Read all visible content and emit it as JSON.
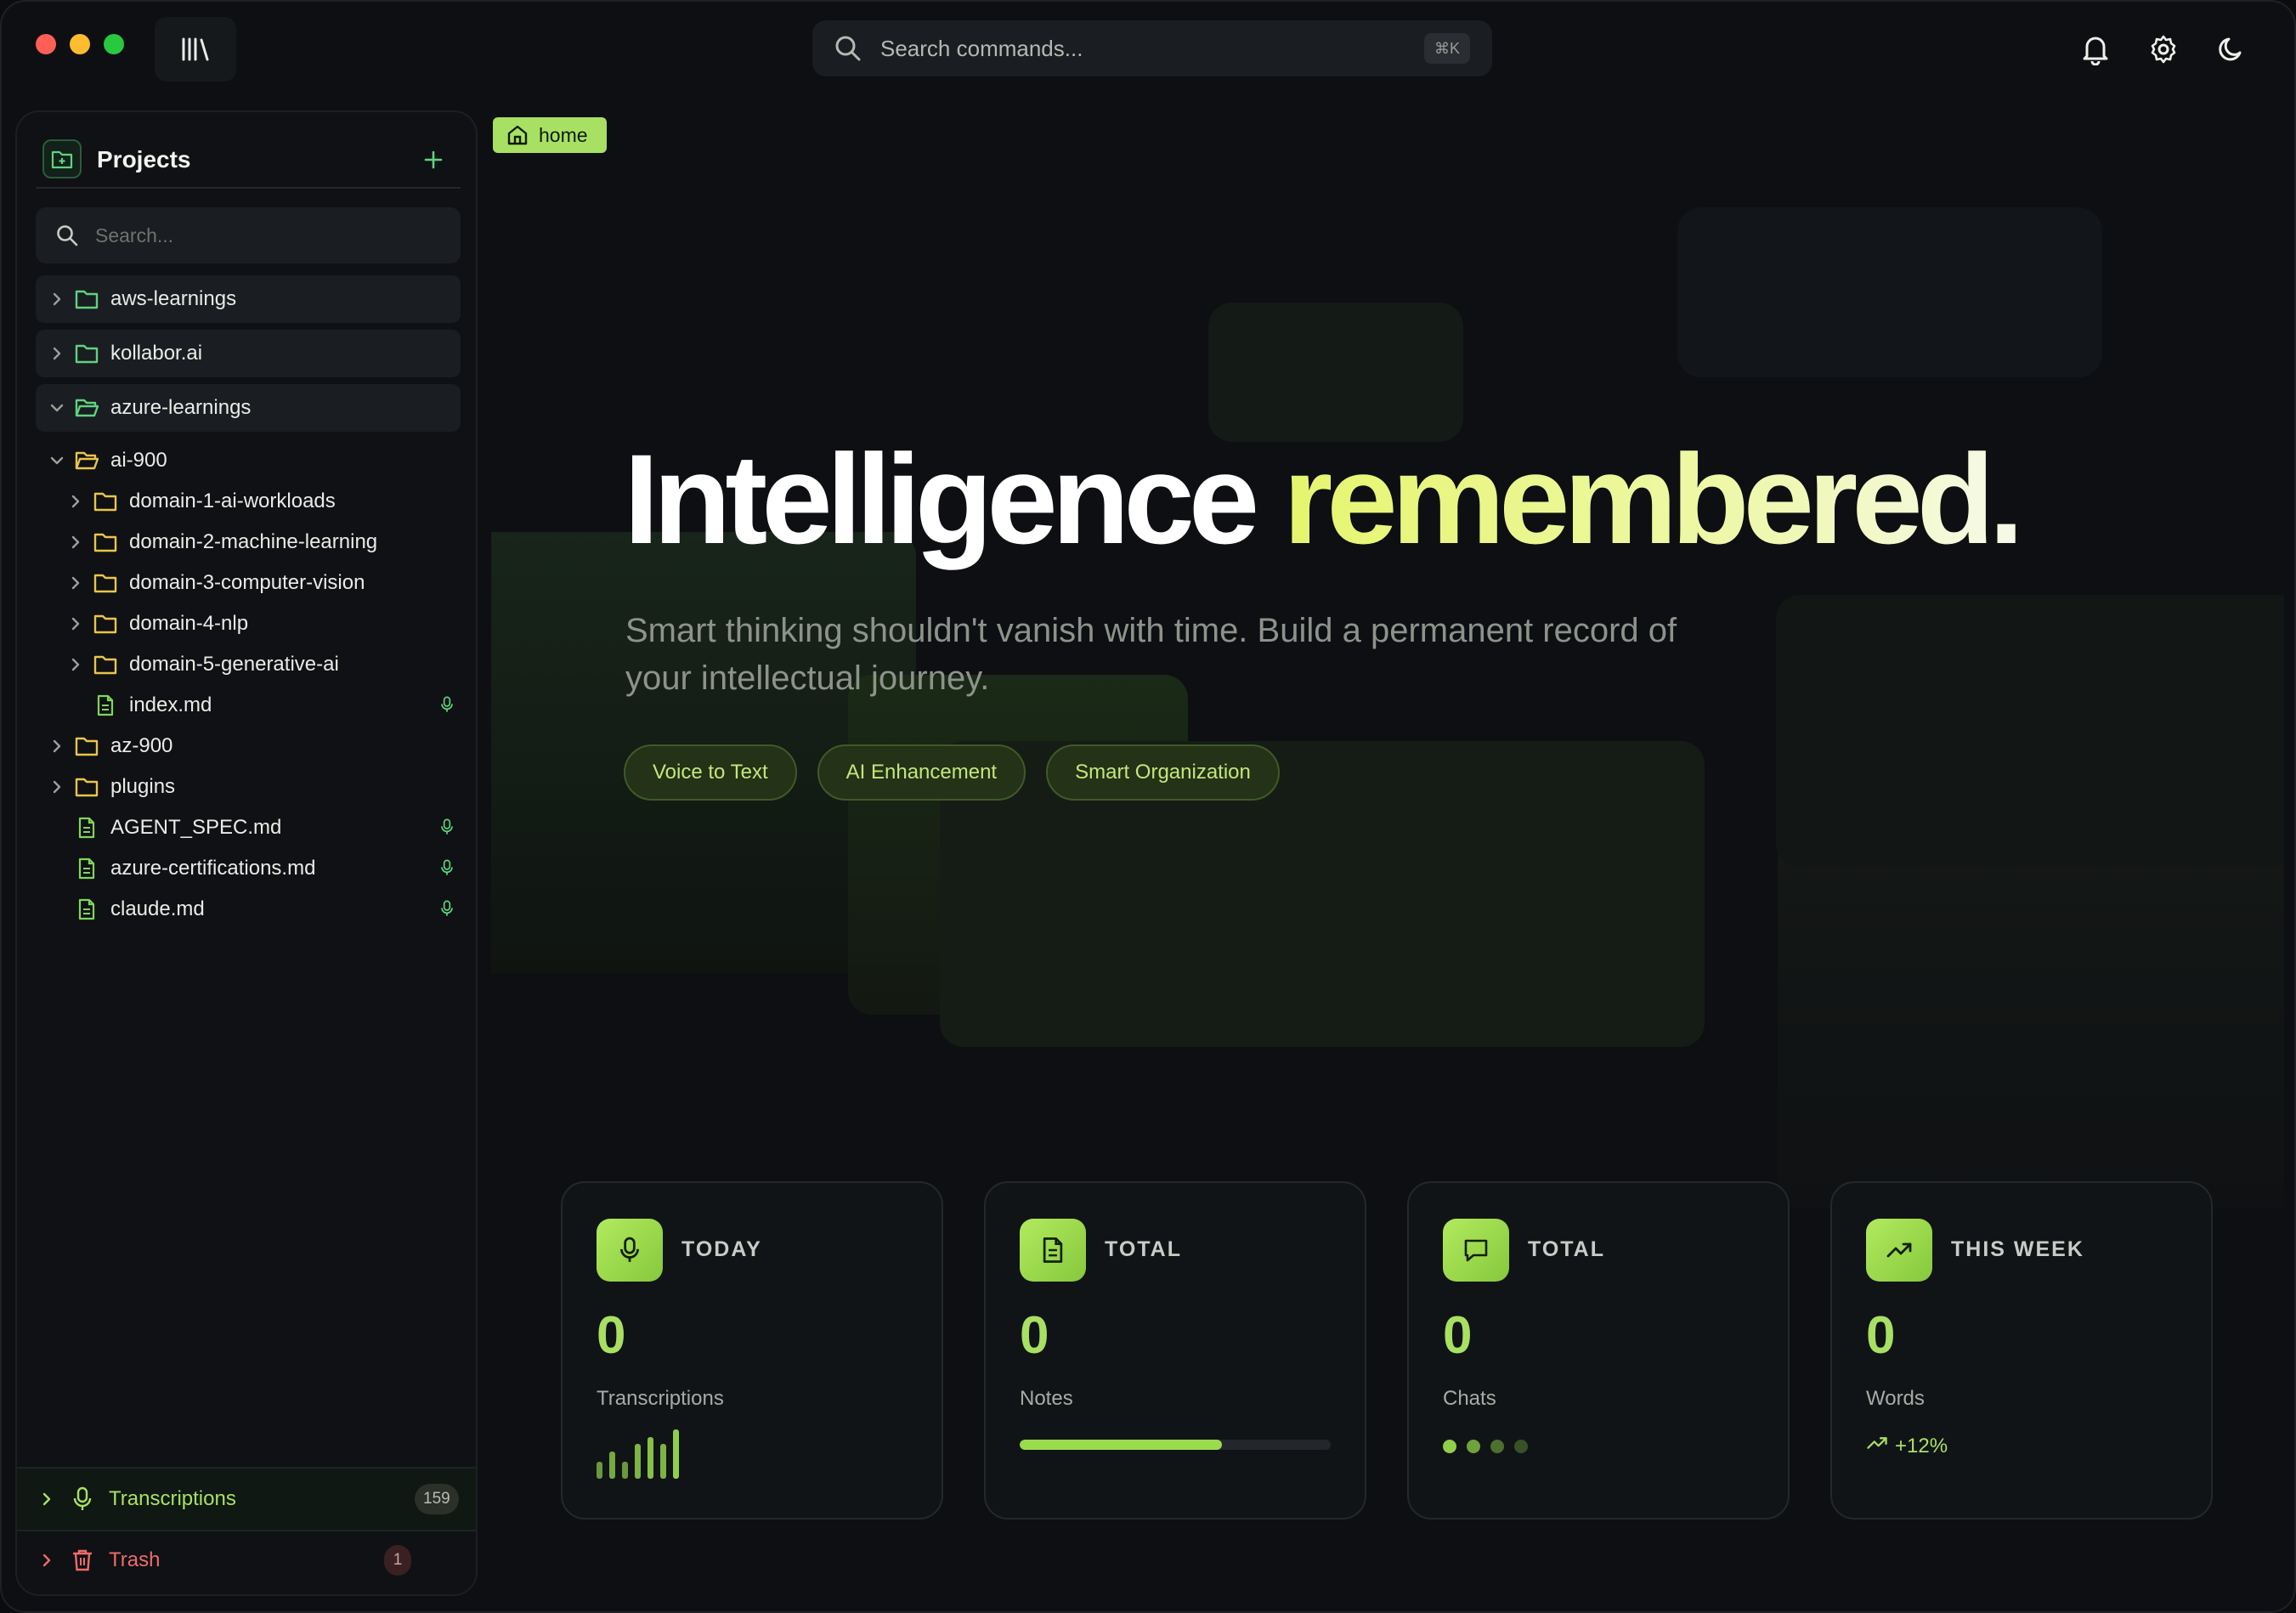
{
  "colors": {
    "accent": "#a8e063",
    "accent_yellow": "#e6f56e",
    "trash": "#ef6b6b",
    "bg": "#0d0f12"
  },
  "topbar": {
    "search_placeholder": "Search commands...",
    "shortcut": "⌘K",
    "icons": [
      "bell-icon",
      "gear-icon",
      "moon-icon"
    ]
  },
  "sidebar": {
    "title": "Projects",
    "search_placeholder": "Search...",
    "top_folders": [
      {
        "label": "aws-learnings",
        "expanded": false
      },
      {
        "label": "kollabor.ai",
        "expanded": false
      },
      {
        "label": "azure-learnings",
        "expanded": true
      }
    ],
    "tree": [
      {
        "label": "ai-900",
        "type": "folder",
        "expanded": true,
        "depth": 1
      },
      {
        "label": "domain-1-ai-workloads",
        "type": "folder",
        "depth": 2
      },
      {
        "label": "domain-2-machine-learning",
        "type": "folder",
        "depth": 2
      },
      {
        "label": "domain-3-computer-vision",
        "type": "folder",
        "depth": 2
      },
      {
        "label": "domain-4-nlp",
        "type": "folder",
        "depth": 2
      },
      {
        "label": "domain-5-generative-ai",
        "type": "folder",
        "depth": 2
      },
      {
        "label": "index.md",
        "type": "file",
        "depth": 2,
        "has_audio": true
      },
      {
        "label": "az-900",
        "type": "folder",
        "depth": 1
      },
      {
        "label": "plugins",
        "type": "folder",
        "depth": 1
      },
      {
        "label": "AGENT_SPEC.md",
        "type": "file",
        "depth": 1,
        "has_audio": true
      },
      {
        "label": "azure-certifications.md",
        "type": "file",
        "depth": 1,
        "has_audio": true
      },
      {
        "label": "claude.md",
        "type": "file",
        "depth": 1,
        "has_audio": true
      }
    ],
    "transcriptions": {
      "label": "Transcriptions",
      "count": "159"
    },
    "trash": {
      "label": "Trash",
      "count": "1"
    }
  },
  "breadcrumb": {
    "label": "home"
  },
  "hero": {
    "title_main": "Intelligence",
    "title_accent": "remembered.",
    "subtitle": "Smart thinking shouldn't vanish with time. Build a permanent record of your intellectual journey.",
    "pills": [
      "Voice to Text",
      "AI Enhancement",
      "Smart Organization"
    ]
  },
  "stats": [
    {
      "tag": "TODAY",
      "value": "0",
      "label": "Transcriptions",
      "icon": "mic-icon",
      "bar_heights": [
        0.35,
        0.55,
        0.35,
        0.7,
        0.85,
        0.7,
        1.0
      ]
    },
    {
      "tag": "TOTAL",
      "value": "0",
      "label": "Notes",
      "icon": "document-icon",
      "progress": 0.65
    },
    {
      "tag": "TOTAL",
      "value": "0",
      "label": "Chats",
      "icon": "chat-icon",
      "dots": 4
    },
    {
      "tag": "THIS WEEK",
      "value": "0",
      "label": "Words",
      "icon": "trending-up-icon",
      "trend": "+12%"
    }
  ]
}
